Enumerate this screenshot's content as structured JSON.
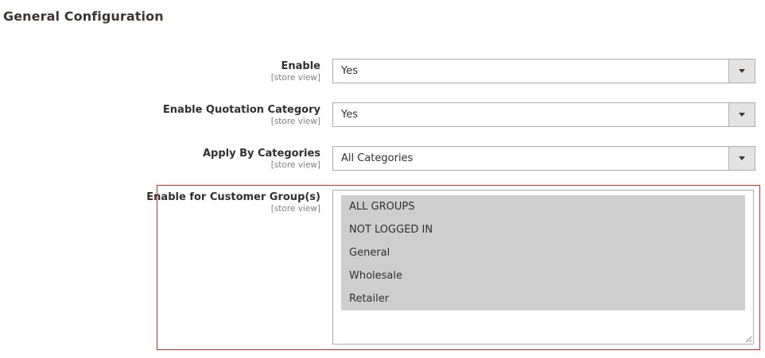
{
  "section": {
    "title": "General Configuration"
  },
  "fields": [
    {
      "label": "Enable",
      "scope": "[store view]",
      "value": "Yes",
      "icon": "chevron-down-icon"
    },
    {
      "label": "Enable Quotation Category",
      "scope": "[store view]",
      "value": "Yes",
      "icon": "chevron-down-icon"
    },
    {
      "label": "Apply By Categories",
      "scope": "[store view]",
      "value": "All Categories",
      "icon": "chevron-down-icon"
    }
  ],
  "customer_groups": {
    "label": "Enable for Customer Group(s)",
    "scope": "[store view]",
    "options": [
      "ALL GROUPS",
      "NOT LOGGED IN",
      "General",
      "Wholesale",
      "Retailer"
    ],
    "selected_background": "#cecece",
    "highlight_color": "#e02b27"
  }
}
